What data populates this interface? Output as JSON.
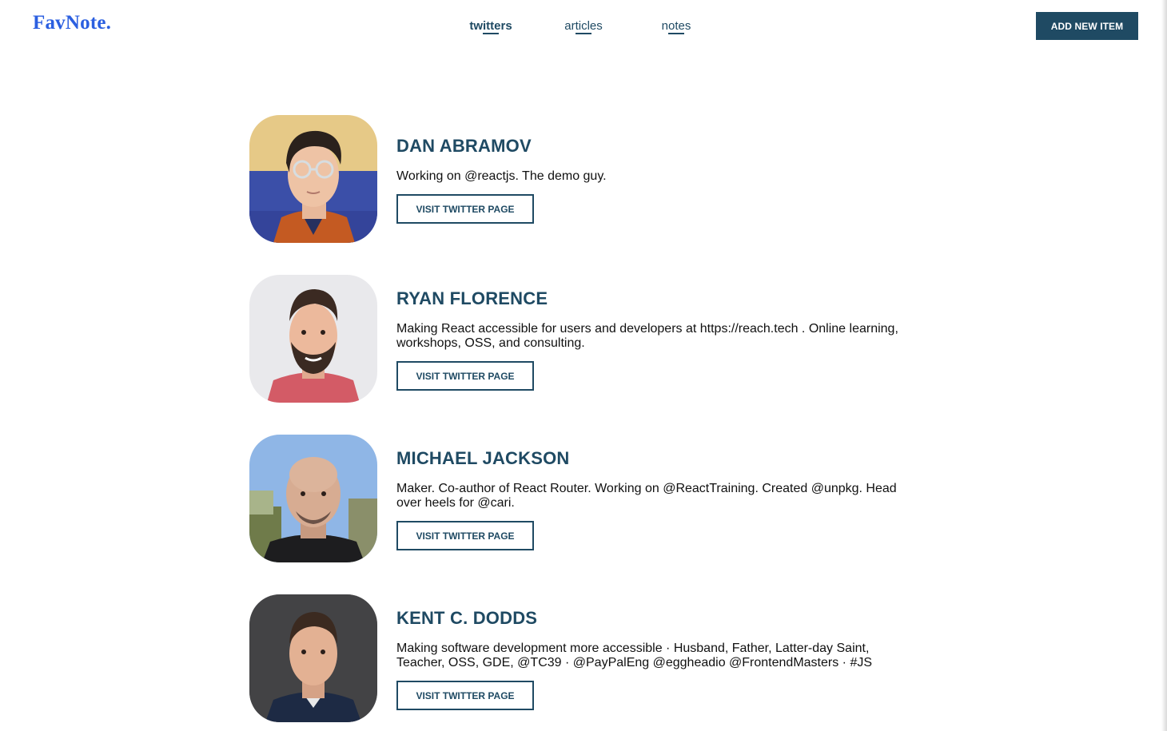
{
  "header": {
    "logo": "FavNote.",
    "nav": [
      {
        "label": "twitters",
        "active": true
      },
      {
        "label": "articles",
        "active": false
      },
      {
        "label": "notes",
        "active": false
      }
    ],
    "add_button": "ADD NEW ITEM"
  },
  "colors": {
    "brand": "#1f4a63",
    "logo": "#2b5fe0"
  },
  "cards": [
    {
      "name": "DAN ABRAMOV",
      "description": "Working on @reactjs. The demo guy.",
      "button": "VISIT TWITTER PAGE",
      "avatar": "dan-abramov-avatar"
    },
    {
      "name": "RYAN FLORENCE",
      "description": "Making React accessible for users and developers at https://reach.tech . Online learning, workshops, OSS, and consulting.",
      "button": "VISIT TWITTER PAGE",
      "avatar": "ryan-florence-avatar"
    },
    {
      "name": "MICHAEL JACKSON",
      "description": "Maker. Co-author of React Router. Working on @ReactTraining. Created @unpkg. Head over heels for @cari.",
      "button": "VISIT TWITTER PAGE",
      "avatar": "michael-jackson-avatar"
    },
    {
      "name": "KENT C. DODDS",
      "description": "Making software development more accessible · Husband, Father, Latter-day Saint, Teacher, OSS, GDE, @TC39 · @PayPalEng @eggheadio @FrontendMasters · #JS",
      "button": "VISIT TWITTER PAGE",
      "avatar": "kent-c-dodds-avatar"
    }
  ]
}
